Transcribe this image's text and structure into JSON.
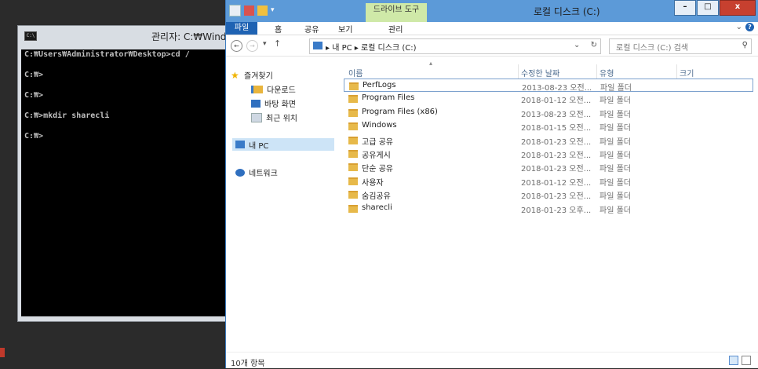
{
  "cmd": {
    "title": "관리자: C:₩Windows",
    "lines": [
      "C:₩Users₩Administrator₩Desktop>cd /",
      "",
      "C:₩>",
      "",
      "C:₩>",
      "",
      "C:₩>mkdir sharecli",
      "",
      "C:₩>"
    ]
  },
  "explorer": {
    "context_tab": "드라이브 도구",
    "window_title": "로컬 디스크 (C:)",
    "minimize": "–",
    "maximize": "□",
    "close": "x",
    "ribbon": {
      "file": "파일",
      "home": "홈",
      "share": "공유",
      "view": "보기",
      "manage": "관리",
      "expand": "⌄"
    },
    "address": {
      "path": "▸ 내 PC ▸ 로컬 디스크 (C:)",
      "dropdown": "⌄",
      "refresh": "↻"
    },
    "search": {
      "placeholder": "로컬 디스크 (C:) 검색"
    },
    "nav": {
      "favorites": "즐겨찾기",
      "downloads": "다운로드",
      "desktop": "바탕 화면",
      "recent": "최근 위치",
      "this_pc": "내 PC",
      "network": "네트워크"
    },
    "columns": {
      "name": "이름",
      "date": "수정한 날짜",
      "type": "유형",
      "size": "크기"
    },
    "files": [
      {
        "name": "PerfLogs",
        "date": "2013-08-23 오전...",
        "type": "파일 폴더"
      },
      {
        "name": "Program Files",
        "date": "2018-01-12 오전...",
        "type": "파일 폴더"
      },
      {
        "name": "Program Files (x86)",
        "date": "2013-08-23 오전...",
        "type": "파일 폴더"
      },
      {
        "name": "Windows",
        "date": "2018-01-15 오전...",
        "type": "파일 폴더"
      },
      {
        "name": "고급 공유",
        "date": "2018-01-23 오전...",
        "type": "파일 폴더"
      },
      {
        "name": "공유게시",
        "date": "2018-01-23 오전...",
        "type": "파일 폴더"
      },
      {
        "name": "단순 공유",
        "date": "2018-01-23 오전...",
        "type": "파일 폴더"
      },
      {
        "name": "사용자",
        "date": "2018-01-12 오전...",
        "type": "파일 폴더"
      },
      {
        "name": "숨김공유",
        "date": "2018-01-23 오전...",
        "type": "파일 폴더"
      },
      {
        "name": "sharecli",
        "date": "2018-01-23 오후...",
        "type": "파일 폴더"
      }
    ],
    "status": "10개 항목"
  }
}
